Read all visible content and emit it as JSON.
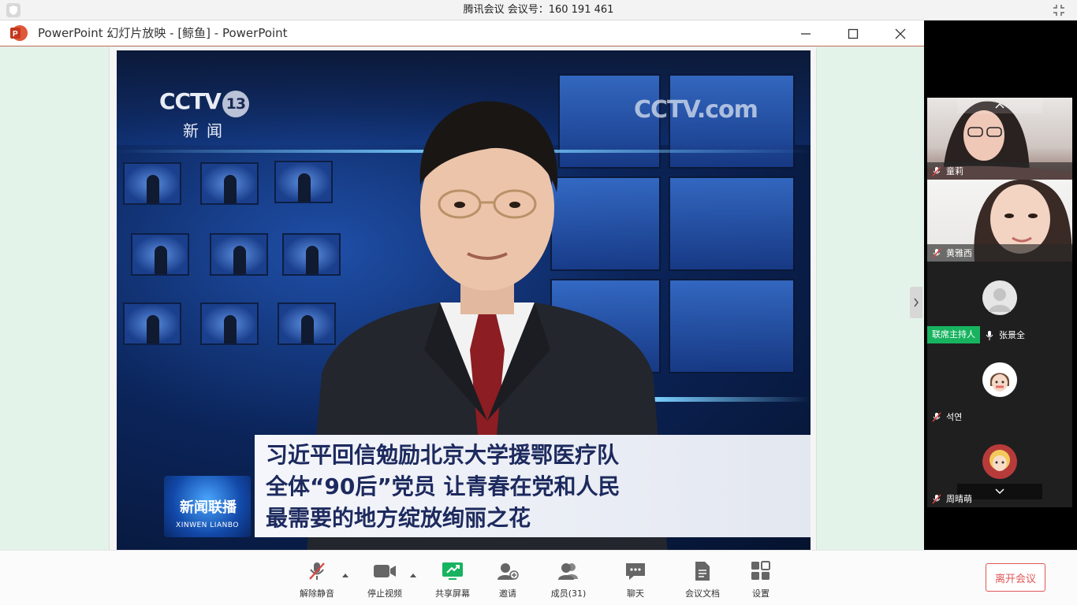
{
  "meeting": {
    "title": "腾讯会议 会议号：160 191 461"
  },
  "ppt_window": {
    "title": "PowerPoint 幻灯片放映 - [鲸鱼] - PowerPoint",
    "minimize_icon": "minimize-icon",
    "maximize_icon": "maximize-icon",
    "close_icon": "close-icon"
  },
  "slide": {
    "channel_logo": "CCTV",
    "channel_number": "13",
    "channel_sub": "新闻",
    "watermark": "CCTV.com",
    "program_logo_title": "新闻联播",
    "program_logo_sub": "XINWEN LIANBO",
    "caption_lines": [
      "习近平回信勉励北京大学援鄂医疗队",
      "全体“90后”党员 让青春在党和人民",
      "最需要的地方绽放绚丽之花"
    ]
  },
  "participants": [
    {
      "name": "童莉",
      "mic": "muted"
    },
    {
      "name": "黄雅西",
      "mic": "muted"
    },
    {
      "name": "张景全",
      "mic": "on",
      "badge": "联席主持人"
    },
    {
      "name": "석연",
      "mic": "muted"
    },
    {
      "name": "周晴萌",
      "mic": "muted"
    }
  ],
  "toolbar": {
    "unmute": "解除静音",
    "stop_video": "停止视频",
    "share_screen": "共享屏幕",
    "invite": "邀请",
    "members": "成员(31)",
    "chat": "聊天",
    "docs": "会议文档",
    "settings": "设置",
    "leave": "离开会议"
  },
  "colors": {
    "accent_green": "#17b35f",
    "leave_red": "#e05555",
    "slide_bg": "#e3f3ea"
  }
}
